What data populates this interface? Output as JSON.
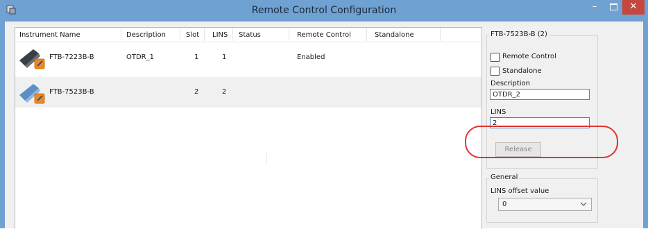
{
  "window": {
    "title": "Remote Control Configuration",
    "accent": "#6fa1d2",
    "close_color": "#c7463d"
  },
  "table": {
    "columns": [
      "Instrument Name",
      "Description",
      "Slot",
      "LINS",
      "Status",
      "Remote Control",
      "Standalone"
    ],
    "rows": [
      {
        "name": "FTB-7223B-B",
        "description": "OTDR_1",
        "slot": "1",
        "lins": "1",
        "status": "",
        "remote_control": "Enabled",
        "standalone": ""
      },
      {
        "name": "FTB-7523B-B",
        "description": "",
        "slot": "2",
        "lins": "2",
        "status": "",
        "remote_control": "",
        "standalone": ""
      }
    ]
  },
  "details": {
    "group_title": "FTB-7523B-B (2)",
    "remote_control_label": "Remote Control",
    "standalone_label": "Standalone",
    "description_label": "Description",
    "description_value": "OTDR_2",
    "lins_label": "LINS",
    "lins_value": "2",
    "release_label": "Release"
  },
  "general": {
    "group_title": "General",
    "offset_label": "LINS offset value",
    "offset_value": "0"
  },
  "annotation": {
    "color": "#e0332f"
  }
}
